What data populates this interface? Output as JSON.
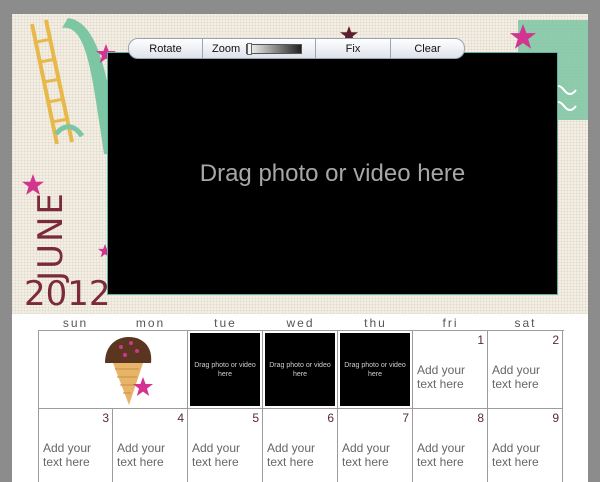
{
  "toolbar": {
    "rotate_label": "Rotate",
    "zoom_label": "Zoom",
    "zoom_level": 0,
    "fix_label": "Fix",
    "clear_label": "Clear"
  },
  "header": {
    "month": "JUNE",
    "year": "2012"
  },
  "photo_drop": {
    "label": "Drag photo or video here"
  },
  "calendar": {
    "weekdays": [
      "sun",
      "mon",
      "tue",
      "wed",
      "thu",
      "fri",
      "sat"
    ],
    "mini_drop_label": "Drag photo or video here",
    "placeholder_text": "Add your text here",
    "day_numbers": [
      "1",
      "2",
      "3",
      "4",
      "5",
      "6",
      "7",
      "8",
      "9"
    ]
  },
  "colors": {
    "star_magenta": "#d2348f",
    "star_maroon": "#5a1e2c",
    "slide_green": "#7cc6a4",
    "month_text": "#7a2a3a",
    "photo_border": "#5fb0a8"
  }
}
